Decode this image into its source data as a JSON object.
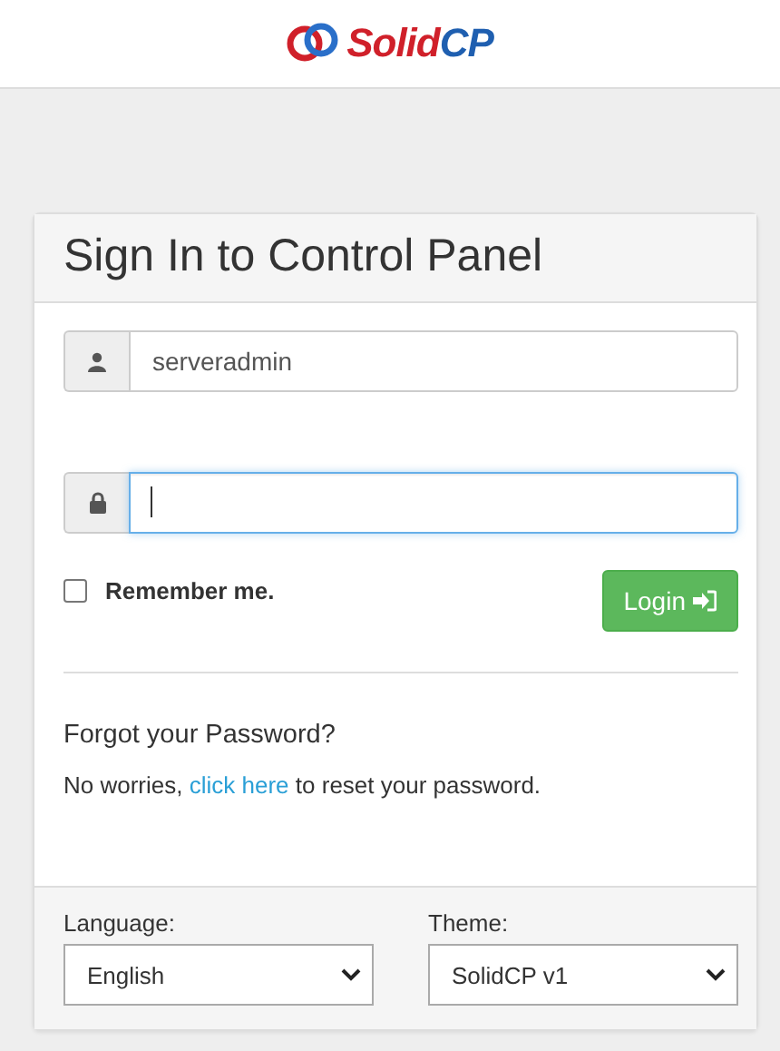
{
  "header": {
    "logo_parts": [
      "Solid",
      "CP"
    ]
  },
  "panel": {
    "title": "Sign In to Control Panel",
    "fields": [
      {
        "kind": "user",
        "value": "serveradmin",
        "focused": false
      },
      {
        "kind": "lock",
        "focused": true
      }
    ],
    "remember": {
      "label": "Remember me.",
      "checked": false
    },
    "login_button": "Login",
    "forgot_title": "Forgot your Password?",
    "reset_text": {
      "before": "No worries,",
      "link": "click here",
      "after": "to reset your password."
    },
    "selects": [
      {
        "label": "Language:",
        "value": "English"
      },
      {
        "label": "Theme:",
        "value": "SolidCP v1"
      }
    ]
  }
}
